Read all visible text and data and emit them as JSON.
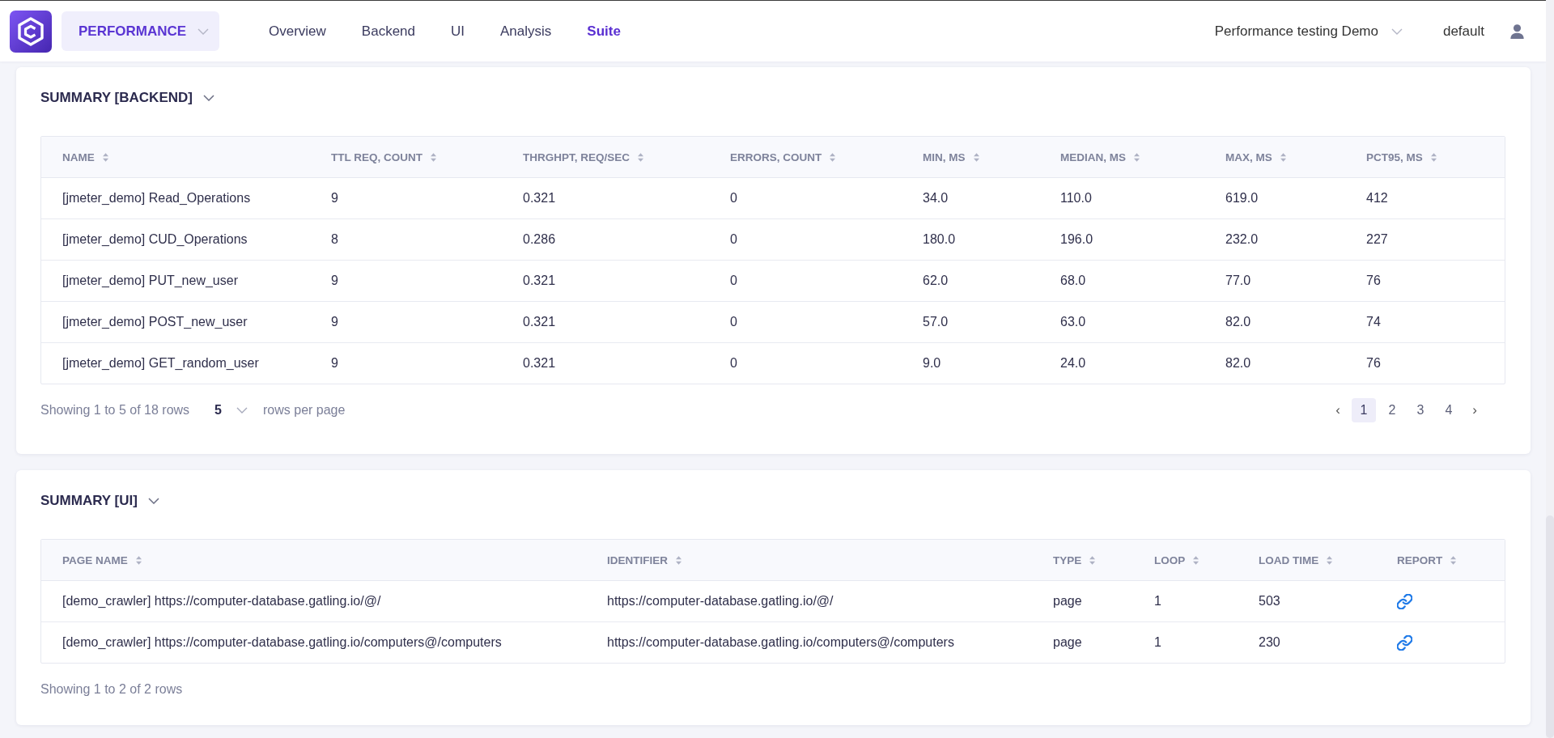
{
  "header": {
    "product_switcher": {
      "label": "PERFORMANCE"
    },
    "nav": [
      {
        "label": "Overview",
        "selected": false
      },
      {
        "label": "Backend",
        "selected": false
      },
      {
        "label": "UI",
        "selected": false
      },
      {
        "label": "Analysis",
        "selected": false
      },
      {
        "label": "Suite",
        "selected": true
      }
    ],
    "project_selector": {
      "label": "Performance testing Demo"
    },
    "user": {
      "name": "default"
    }
  },
  "backend_summary": {
    "title": "SUMMARY [BACKEND]",
    "columns": [
      {
        "label": "NAME",
        "kind": "text"
      },
      {
        "label": "TTL REQ, COUNT",
        "kind": "text"
      },
      {
        "label": "THRGHPT, REQ/SEC",
        "kind": "text"
      },
      {
        "label": "ERRORS, COUNT",
        "kind": "text"
      },
      {
        "label": "MIN, MS",
        "kind": "text"
      },
      {
        "label": "MEDIAN, MS",
        "kind": "text"
      },
      {
        "label": "MAX, MS",
        "kind": "text"
      },
      {
        "label": "PCT95, MS",
        "kind": "text"
      }
    ],
    "rows": [
      [
        "[jmeter_demo] Read_Operations",
        "9",
        "0.321",
        "0",
        "34.0",
        "110.0",
        "619.0",
        "412"
      ],
      [
        "[jmeter_demo] CUD_Operations",
        "8",
        "0.286",
        "0",
        "180.0",
        "196.0",
        "232.0",
        "227"
      ],
      [
        "[jmeter_demo] PUT_new_user",
        "9",
        "0.321",
        "0",
        "62.0",
        "68.0",
        "77.0",
        "76"
      ],
      [
        "[jmeter_demo] POST_new_user",
        "9",
        "0.321",
        "0",
        "57.0",
        "63.0",
        "82.0",
        "74"
      ],
      [
        "[jmeter_demo] GET_random_user",
        "9",
        "0.321",
        "0",
        "9.0",
        "24.0",
        "82.0",
        "76"
      ]
    ],
    "footer": {
      "showing": "Showing 1 to 5 of 18 rows",
      "page_size": "5",
      "page_size_label": "rows per page",
      "pagination": {
        "prev": "‹",
        "pages": [
          {
            "label": "1",
            "selected": true
          },
          {
            "label": "2",
            "selected": false
          },
          {
            "label": "3",
            "selected": false
          },
          {
            "label": "4",
            "selected": false
          }
        ],
        "next": "›"
      }
    }
  },
  "ui_summary": {
    "title": "SUMMARY [UI]",
    "columns": [
      {
        "label": "PAGE NAME",
        "kind": "text"
      },
      {
        "label": "IDENTIFIER",
        "kind": "text"
      },
      {
        "label": "TYPE",
        "kind": "text"
      },
      {
        "label": "LOOP",
        "kind": "text"
      },
      {
        "label": "LOAD TIME",
        "kind": "text"
      },
      {
        "label": "REPORT",
        "kind": "link"
      }
    ],
    "rows": [
      [
        "[demo_crawler] https://computer-database.gatling.io/@/",
        "https://computer-database.gatling.io/@/",
        "page",
        "1",
        "503"
      ],
      [
        "[demo_crawler] https://computer-database.gatling.io/computers@/computers",
        "https://computer-database.gatling.io/computers@/computers",
        "page",
        "1",
        "230"
      ]
    ],
    "footer": {
      "showing": "Showing 1 to 2 of 2 rows"
    }
  }
}
